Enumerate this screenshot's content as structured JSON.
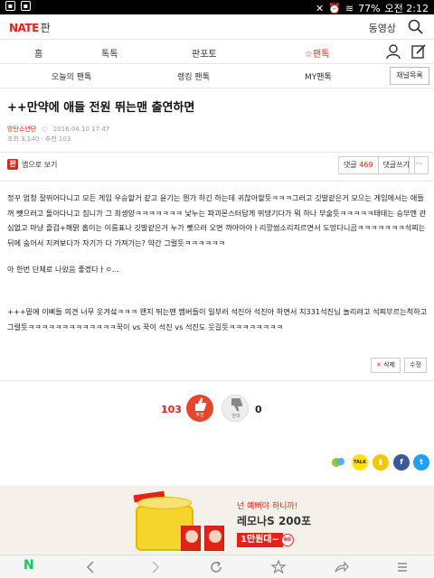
{
  "status_bar": {
    "left_icons": [
      "image-icon",
      "image-icon"
    ],
    "battery": "77%",
    "time": "오전 2:12"
  },
  "header": {
    "logo": "NATE",
    "section": "판",
    "video_link": "동영상"
  },
  "main_nav": {
    "tabs": [
      {
        "label": "홈",
        "active": false
      },
      {
        "label": "톡톡",
        "active": false
      },
      {
        "label": "판포토",
        "active": false
      },
      {
        "label": "팬톡",
        "active": true
      }
    ]
  },
  "sub_nav": {
    "items": [
      "오늘의 팬톡",
      "랭킹 팬톡",
      "MY팬톡"
    ],
    "channel_button": "채널목록"
  },
  "post": {
    "title": "++만약에 애들 전원 뛰는맨 출연하면",
    "author": "방탄소년단",
    "date": "2016.04.10 17:47",
    "stats": "조회 3,140 · 추천 103",
    "app_view": "앱으로 보기",
    "comment_label": "댓글",
    "comment_count": "469",
    "write_comment": "댓글쓰기",
    "more": "···",
    "paragraph1": "정꾸 엄청 잘뛰어다니고 모든 게임 우승할거 같고 윤기는 뭔가 하긴 하는데 귀찮아할듯ㅋㅋㅋ그러고 깃발같은거 모으는 게임에서는 애들꺼 뺏으러고 돌아다니고 짐니가 그 희생양ㅋㅋㅋㅋㅋㅋㅋ 낯누는 파괴몬스터답게 뛰댕기다가 뭐 하나 부술듯ㅋㅋㅋㅋㅋ태태는 승부엔 관심없고 마냥 즐겁+해맑 홉이는 이름표나 깃발같은거 누가 뺏으러 오면 꺄아아아ㅏ리깡썸소리지르면서 도망다니곰ㅋㅋㅋㅋㅋㅋㅋ석찌는 뒤에 숨어서 지켜보다가 자기가 다 가져가는? 약간 그럴듯ㅋㅋㅋㅋㅋㅋ",
    "paragraph2": "아 한번 단체로 나왔음 좋겠다ㅏㅇ...",
    "paragraph3": "+++밑에 이삐들 의견 너무 웃겨섴ㅋㅋㅋ 왠지 뛰는맨 멤버들이 일부러 석진아 석진아 하면서 지331석진님 놀리려고 석찌부르는척하고 그럴듯ㅋㅋㅋㅋㅋㅋㅋㅋㅋㅋㅋㅋㅋ꾹이 vs 꾹이 석진 vs 석진도 웃길듯ㅋㅋㅋㅋㅋㅋㅋㅋ",
    "delete_label": "삭제",
    "edit_label": "수정",
    "vote_up_count": "103",
    "vote_up_label": "추천",
    "vote_down_count": "0",
    "vote_down_label": "반대"
  },
  "share": {
    "icons": [
      "line-icon",
      "kakaotalk-icon",
      "kakaostory-icon",
      "facebook-icon",
      "twitter-icon"
    ],
    "talk_label": "TALK"
  },
  "ad": {
    "line1": "넌 예뻐야 하니까!",
    "line2": "레모나S 200포",
    "price": "1만원대~",
    "badge": "60"
  },
  "colors": {
    "brand_red": "#e2231a",
    "naver_green": "#03cf5d"
  }
}
